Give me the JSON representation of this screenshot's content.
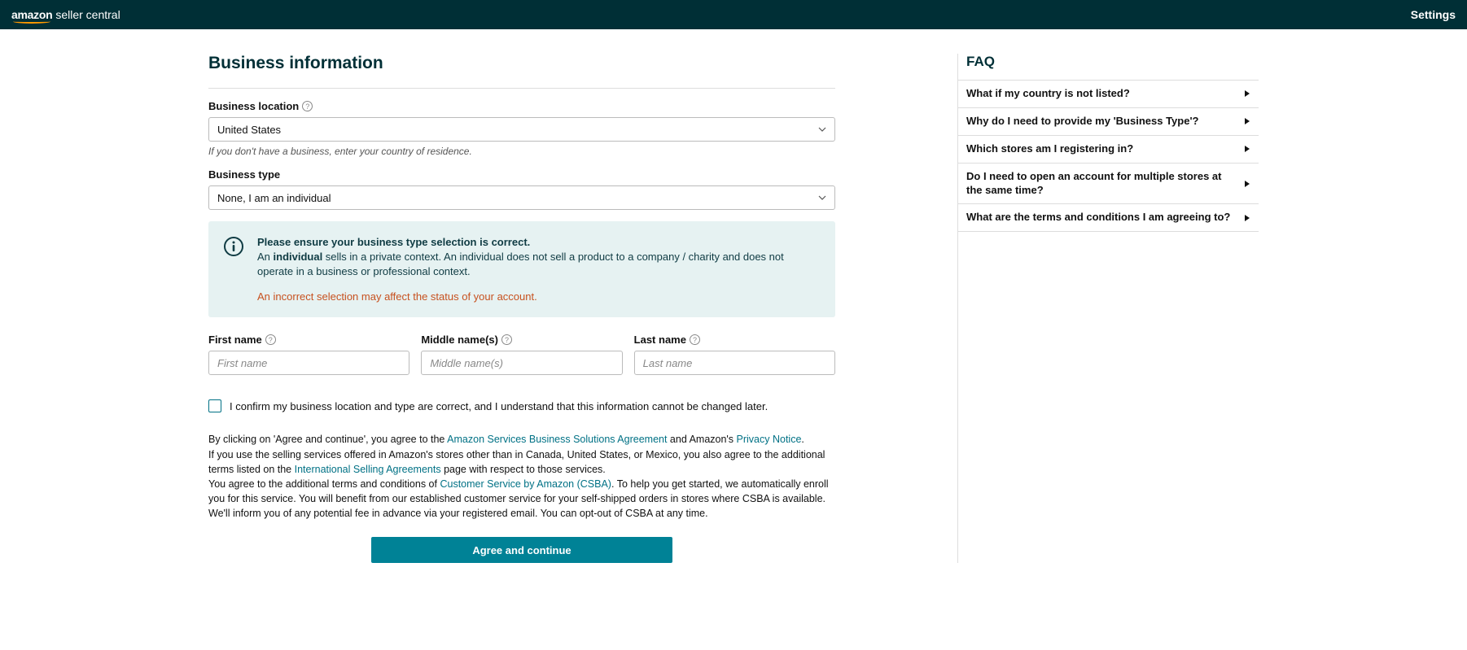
{
  "header": {
    "logo_amazon": "amazon",
    "logo_suffix": "seller central",
    "settings_label": "Settings"
  },
  "page_title": "Business information",
  "business_location": {
    "label": "Business location",
    "value": "United States",
    "hint": "If you don't have a business, enter your country of residence."
  },
  "business_type": {
    "label": "Business type",
    "value": "None, I am an individual"
  },
  "info_box": {
    "title": "Please ensure your business type selection is correct.",
    "body_prefix": "An ",
    "body_bold": "individual",
    "body_suffix": " sells in a private context. An individual does not sell a product to a company / charity and does not operate in a business or professional context.",
    "warning": "An incorrect selection may affect the status of your account."
  },
  "name": {
    "first_label": "First name",
    "first_placeholder": "First name",
    "middle_label": "Middle name(s)",
    "middle_placeholder": "Middle name(s)",
    "last_label": "Last name",
    "last_placeholder": "Last name"
  },
  "confirm": {
    "label": "I confirm my business location and type are correct, and I understand that this information cannot be changed later."
  },
  "legal": {
    "p1_a": "By clicking on 'Agree and continue', you agree to the ",
    "p1_link1": "Amazon Services Business Solutions Agreement",
    "p1_b": " and Amazon's ",
    "p1_link2": "Privacy Notice",
    "p1_c": ".",
    "p2_a": "If you use the selling services offered in Amazon's stores other than in Canada, United States, or Mexico, you also agree to the additional terms listed on the ",
    "p2_link1": "International Selling Agreements",
    "p2_b": " page with respect to those services.",
    "p3_a": "You agree to the additional terms and conditions of ",
    "p3_link1": "Customer Service by Amazon (CSBA)",
    "p3_b": ". To help you get started, we automatically enroll you for this service. You will benefit from our established customer service for your self-shipped orders in stores where CSBA is available. We'll inform you of any potential fee in advance via your registered email. You can opt-out of CSBA at any time."
  },
  "cta": {
    "label": "Agree and continue"
  },
  "faq": {
    "title": "FAQ",
    "items": [
      "What if my country is not listed?",
      "Why do I need to provide my 'Business Type'?",
      "Which stores am I registering in?",
      "Do I need to open an account for multiple stores at the same time?",
      "What are the terms and conditions I am agreeing to?"
    ]
  }
}
